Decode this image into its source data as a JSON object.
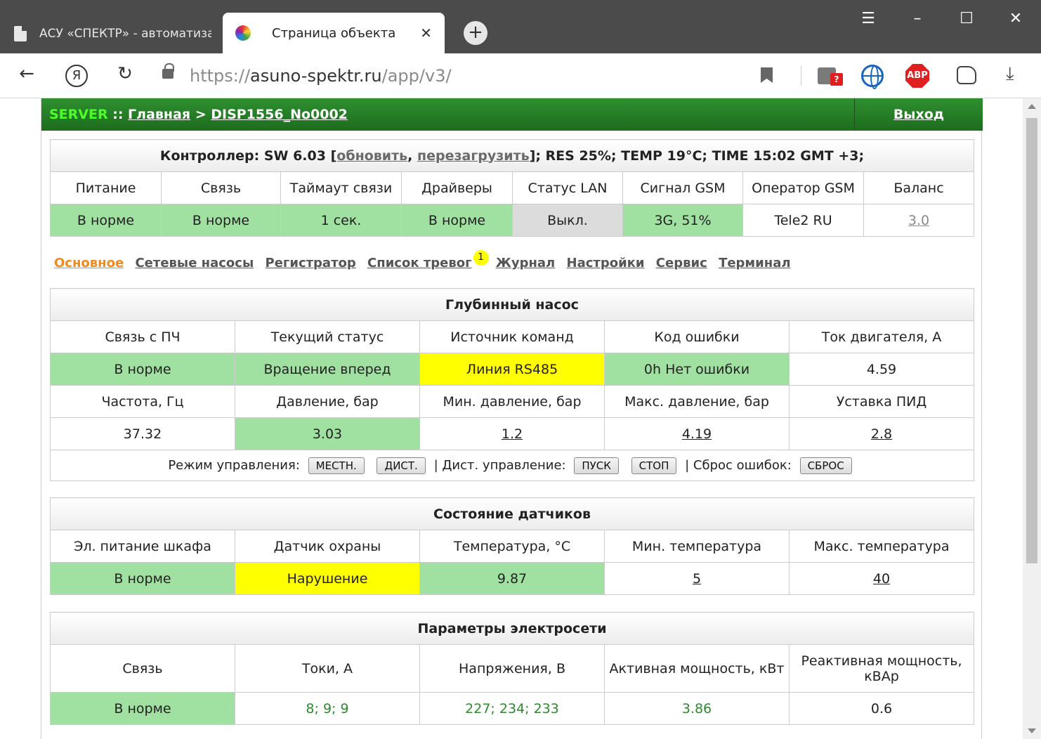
{
  "browser": {
    "inactive_tab_label": "АСУ «СПЕКТР» - автоматизация",
    "active_tab_label": "Страница объекта",
    "url_scheme": "https://",
    "url_host": "asuno-spektr.ru",
    "url_path": "/app/v3/",
    "ya_label": "Я",
    "ext_badge": "?",
    "abp_label": "ABP"
  },
  "header": {
    "server": "SERVER",
    "sep": " :: ",
    "home": "Главная",
    "arrow": " > ",
    "object": "DISP1556_No0002",
    "logout": "Выход"
  },
  "controller": {
    "prefix": "Контроллер: SW 6.03 [",
    "update": "обновить",
    "comma": ", ",
    "reboot": "перезагрузить",
    "suffix": "]; RES 25%; TEMP 19°C; TIME 15:02 GMT +3;",
    "columns": [
      "Питание",
      "Связь",
      "Таймаут связи",
      "Драйверы",
      "Статус LAN",
      "Сигнал GSM",
      "Оператор GSM",
      "Баланс"
    ],
    "values": [
      "В норме",
      "В норме",
      "1 сек.",
      "В норме",
      "Выкл.",
      "3G, 51%",
      "Tele2 RU",
      "3.0"
    ]
  },
  "tabs": {
    "items": [
      "Основное",
      "Сетевые насосы",
      "Регистратор",
      "Список тревог",
      "Журнал",
      "Настройки",
      "Сервис",
      "Терминал"
    ],
    "alarm_badge": "1"
  },
  "pump": {
    "title": "Глубинный насос",
    "row1_headers": [
      "Связь с ПЧ",
      "Текущий статус",
      "Источник команд",
      "Код ошибки",
      "Ток двигателя, А"
    ],
    "row1_values": [
      "В норме",
      "Вращение вперед",
      "Линия RS485",
      "0h Нет ошибки",
      "4.59"
    ],
    "row2_headers": [
      "Частота, Гц",
      "Давление, бар",
      "Мин. давление, бар",
      "Макс. давление, бар",
      "Уставка ПИД"
    ],
    "row2_values": [
      "37.32",
      "3.03",
      "1.2",
      "4.19",
      "2.8"
    ],
    "control_mode_label": "Режим управления:",
    "btn_local": "МЕСТН.",
    "btn_remote": "ДИСТ.",
    "remote_control_label": "| Дист. управление:",
    "btn_start": "ПУСК",
    "btn_stop": "СТОП",
    "reset_label": "| Сброс ошибок:",
    "btn_reset": "СБРОС"
  },
  "sensors": {
    "title": "Состояние датчиков",
    "headers": [
      "Эл. питание шкафа",
      "Датчик охраны",
      "Температура, °С",
      "Мин. температура",
      "Макс. температура"
    ],
    "values": [
      "В норме",
      "Нарушение",
      "9.87",
      "5",
      "40"
    ]
  },
  "power": {
    "title": "Параметры электросети",
    "headers": [
      "Связь",
      "Токи, А",
      "Напряжения, В",
      "Активная мощность, кВт",
      "Реактивная мощность, кВАр"
    ],
    "link_status": "В норме",
    "currents": [
      "8",
      "9",
      "9"
    ],
    "voltages": [
      "227",
      "234",
      "233"
    ],
    "active_power": "3.86",
    "reactive_power": "0.6",
    "value_sep": "; "
  }
}
